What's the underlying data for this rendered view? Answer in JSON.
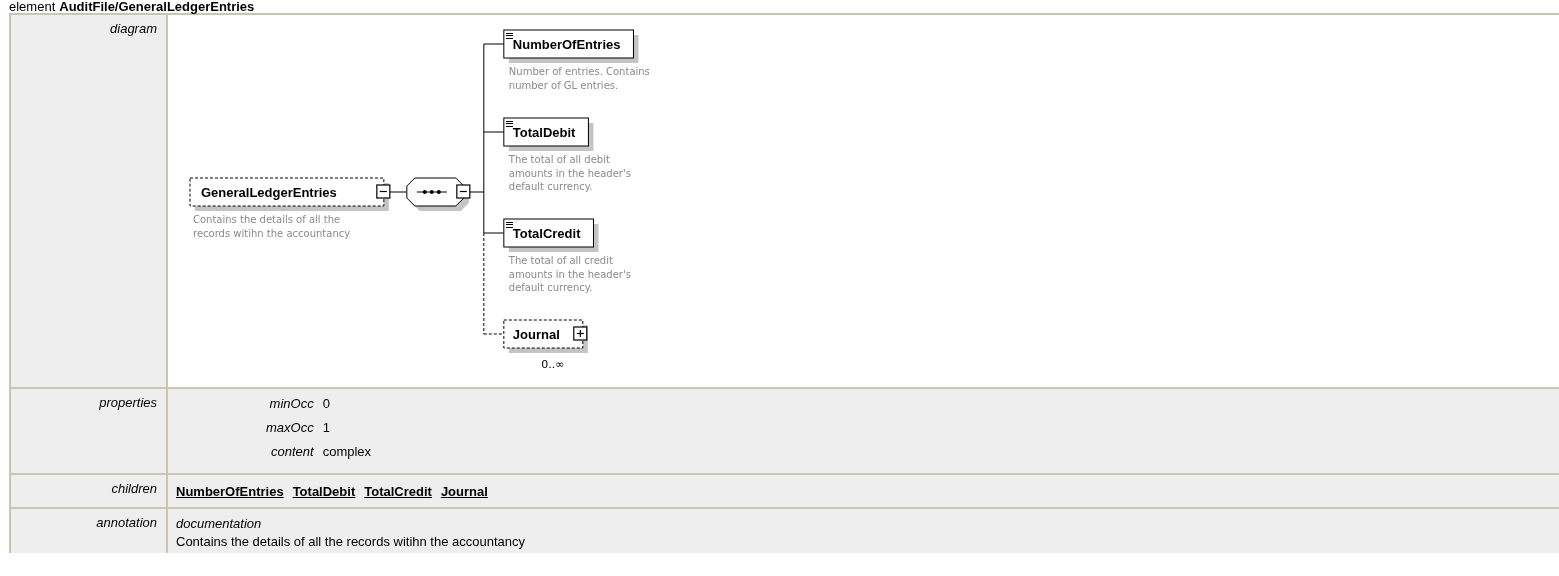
{
  "title": {
    "prefix": "element",
    "path": "AuditFile/GeneralLedgerEntries"
  },
  "diagram": {
    "label": "diagram",
    "root": {
      "name": "GeneralLedgerEntries",
      "optional": true,
      "expanded": true,
      "description": [
        "Contains the details of all the",
        "records witihn the accountancy"
      ]
    },
    "compositor": {
      "kind": "sequence",
      "expanded": true
    },
    "children": [
      {
        "name": "NumberOfEntries",
        "kind": "simple",
        "optional": false,
        "description": [
          "Number of entries. Contains",
          "number of GL entries."
        ]
      },
      {
        "name": "TotalDebit",
        "kind": "simple",
        "optional": false,
        "description": [
          "The total of all debit",
          "amounts in the header's",
          "default currency."
        ]
      },
      {
        "name": "TotalCredit",
        "kind": "simple",
        "optional": false,
        "description": [
          "The total of all credit",
          "amounts in the header's",
          "default currency."
        ]
      },
      {
        "name": "Journal",
        "kind": "complex",
        "optional": true,
        "expanded": false,
        "occurrence": "0..∞"
      }
    ]
  },
  "properties": {
    "label": "properties",
    "items": [
      {
        "name": "minOcc",
        "value": "0"
      },
      {
        "name": "maxOcc",
        "value": "1"
      },
      {
        "name": "content",
        "value": "complex"
      }
    ]
  },
  "children_row": {
    "label": "children",
    "links": [
      "NumberOfEntries",
      "TotalDebit",
      "TotalCredit",
      "Journal"
    ]
  },
  "annotation": {
    "label": "annotation",
    "heading": "documentation",
    "text": "Contains the details of all the records witihn the accountancy"
  }
}
